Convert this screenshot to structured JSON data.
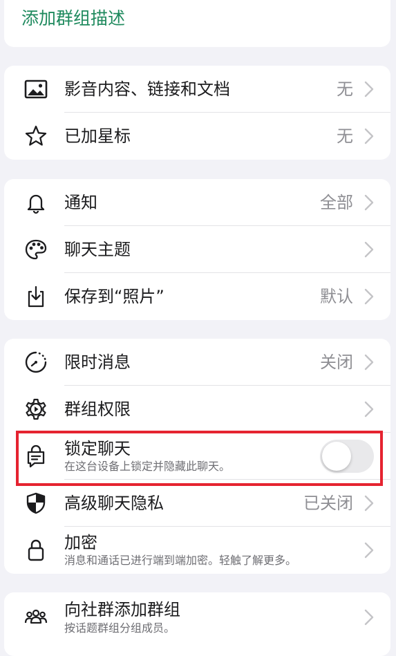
{
  "group": {
    "add_description": "添加群组描述"
  },
  "media_section": {
    "media_links_docs": {
      "label": "影音内容、链接和文档",
      "value": "无",
      "icon": "image-icon"
    },
    "starred": {
      "label": "已加星标",
      "value": "无",
      "icon": "star-icon"
    }
  },
  "settings_section": {
    "notifications": {
      "label": "通知",
      "value": "全部",
      "icon": "bell-icon"
    },
    "chat_theme": {
      "label": "聊天主题",
      "icon": "palette-icon"
    },
    "save_to_photos": {
      "label": "保存到“照片”",
      "value": "默认",
      "icon": "download-icon"
    }
  },
  "privacy_section": {
    "disappearing": {
      "label": "限时消息",
      "value": "关闭",
      "icon": "timer-icon"
    },
    "group_permissions": {
      "label": "群组权限",
      "icon": "gear-icon"
    },
    "lock_chat": {
      "label": "锁定聊天",
      "sublabel": "在这台设备上锁定并隐藏此聊天。",
      "icon": "lock-chat-icon",
      "enabled": false
    },
    "advanced_privacy": {
      "label": "高级聊天隐私",
      "value": "已关闭",
      "icon": "shield-icon"
    },
    "encryption": {
      "label": "加密",
      "sublabel": "消息和通话已进行端到端加密。轻触了解更多。",
      "icon": "lock-icon"
    }
  },
  "community_section": {
    "add_to_community": {
      "label": "向社群添加群组",
      "sublabel": "按话题群组分组成员。",
      "icon": "people-icon"
    }
  },
  "colors": {
    "accent_green": "#1f8a5e",
    "highlight_red": "#e52330",
    "background": "#f2f2f7"
  }
}
